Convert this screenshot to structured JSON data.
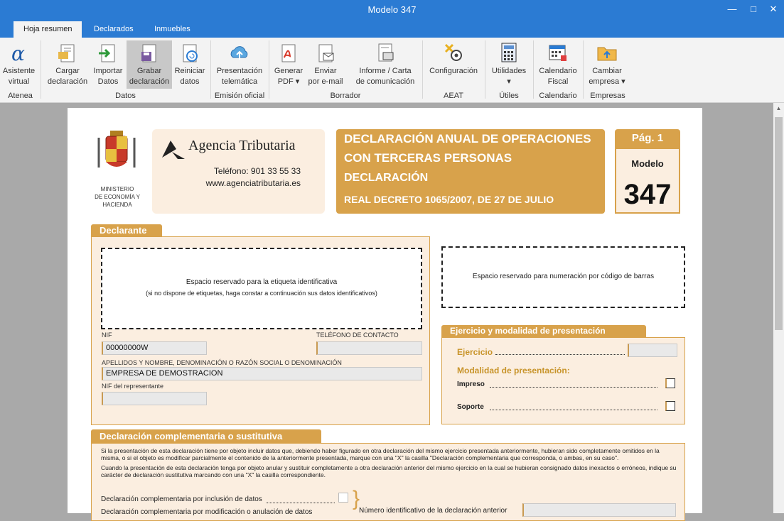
{
  "window": {
    "title": "Modelo 347"
  },
  "tabs": [
    "Hoja resumen",
    "Declarados",
    "Inmuebles"
  ],
  "ribbon": {
    "buttons": [
      {
        "label": "Asistente\nvirtual",
        "icon": "atenea-icon"
      },
      {
        "label": "Cargar\ndeclaración",
        "icon": "load-icon"
      },
      {
        "label": "Importar\nDatos",
        "icon": "import-icon"
      },
      {
        "label": "Grabar\ndeclaración",
        "icon": "save-icon"
      },
      {
        "label": "Reiniciar\ndatos",
        "icon": "reset-icon"
      },
      {
        "label": "Presentación\ntelemática",
        "icon": "cloud-upload-icon"
      },
      {
        "label": "Generar\nPDF ▾",
        "icon": "pdf-icon"
      },
      {
        "label": "Enviar\npor e-mail",
        "icon": "email-icon"
      },
      {
        "label": "Informe / Carta\nde comunicación",
        "icon": "report-icon"
      },
      {
        "label": "Configuración",
        "icon": "gear-icon"
      },
      {
        "label": "Utilidades\n▾",
        "icon": "calculator-icon"
      },
      {
        "label": "Calendario\nFiscal",
        "icon": "calendar-icon"
      },
      {
        "label": "Cambiar\nempresa ▾",
        "icon": "folder-icon"
      }
    ],
    "groups": [
      "Atenea",
      "Datos",
      "Emisión oficial",
      "Borrador",
      "AEAT",
      "Útiles",
      "Calendario",
      "Empresas"
    ]
  },
  "form": {
    "ministry": "MINISTERIO\nDE ECONOMÍA Y\nHACIENDA",
    "agency": "Agencia Tributaria",
    "phone": "Teléfono: 901 33 55 33",
    "web": "www.agenciatributaria.es",
    "title1": "DECLARACIÓN ANUAL DE OPERACIONES",
    "title2": "CON TERCERAS PERSONAS",
    "title3": "DECLARACIÓN",
    "title4": "REAL DECRETO 1065/2007, DE 27 DE JULIO",
    "pag": "Pág. 1",
    "modelo": "Modelo",
    "modelo_num": "347",
    "declarante": "Declarante",
    "etiqueta1": "Espacio reservado para la etiqueta identificativa",
    "etiqueta2": "(si no dispone de etiquetas, haga constar a continuación sus datos identificativos)",
    "barras": "Espacio reservado para numeración por código de barras",
    "nif_label": "NIF",
    "nif_value": "00000000W",
    "tel_label": "TELÉFONO DE CONTACTO",
    "nombre_label": "APELLIDOS Y NOMBRE, DENOMINACIÓN O RAZÓN SOCIAL O DENOMINACIÓN",
    "nombre_value": "EMPRESA DE DEMOSTRACION",
    "rep_label": "NIF del representante",
    "ejercicio_header": "Ejercicio y modalidad de presentación",
    "ejercicio_label": "Ejercicio",
    "modalidad_label": "Modalidad de presentación:",
    "impreso": "Impreso",
    "soporte": "Soporte",
    "comp_header": "Declaración complementaria o sustitutiva",
    "comp_text1": "Si la presentación de esta declaración tiene por objeto incluir datos que, debiendo haber figurado en otra declaración del mismo ejercicio presentada anteriormente, hubieran sido completamente omitidos en la misma, o si el  objeto es modificar parcialmente el contenido de la anteriormente presentada, marque con una \"X\" la casilla \"Declaración complementaria que corresponda, o ambas, en su caso\".",
    "comp_text2": "Cuando la presentación de esta declaración tenga por objeto anular y sustituir completamente a otra declaración anterior del mismo ejercicio en la cual se hubieran consignado datos inexactos o erróneos, indique su carácter de declaración sustitutiva marcando con una \"X\" la casilla correspondiente.",
    "comp_inclusion": "Declaración complementaria por inclusión de datos",
    "comp_modif": "Declaración complementaria por modificación o anulación de datos",
    "num_ident": "Número identificativo de la declaración anterior"
  }
}
